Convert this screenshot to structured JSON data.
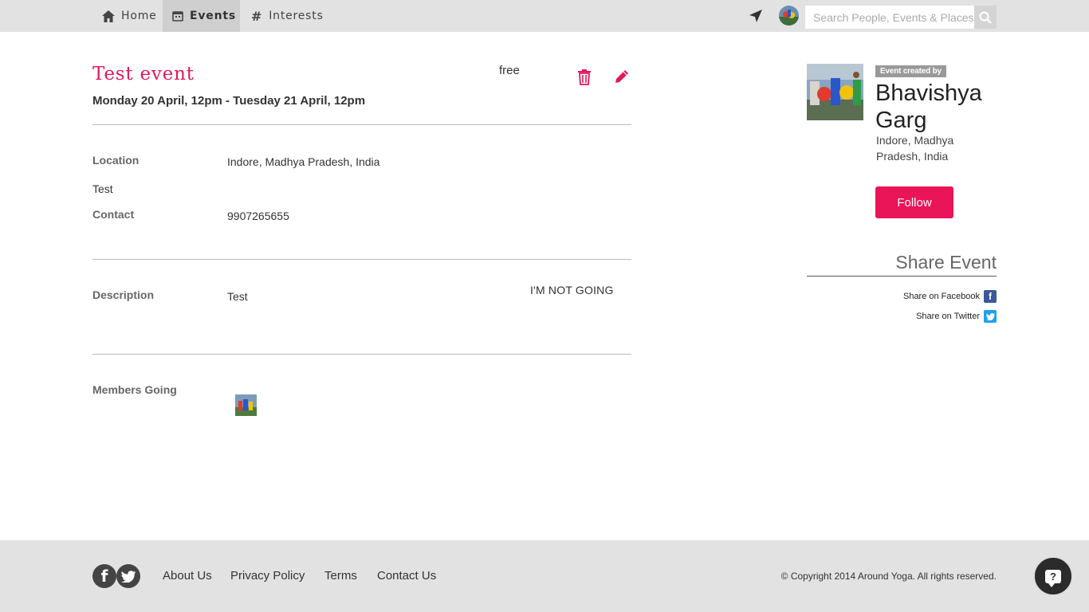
{
  "nav": {
    "tabs": [
      {
        "label": "Home",
        "icon": "home-icon"
      },
      {
        "label": "Events",
        "icon": "calendar-icon",
        "active": true
      },
      {
        "label": "Interests",
        "icon": "hash-icon"
      }
    ],
    "search_placeholder": "Search People, Events & Places"
  },
  "event": {
    "title": "Test event",
    "date_range": "Monday 20 April, 12pm - Tuesday 21 April, 12pm",
    "price": "free",
    "location_label": "Location",
    "location_value": "Indore, Madhya Pradesh, India",
    "venue_text": "Test",
    "contact_label": "Contact",
    "contact_value": "9907265655",
    "description_label": "Description",
    "description_value": "Test",
    "rsvp_label": "I'M NOT GOING",
    "members_label": "Members Going"
  },
  "creator": {
    "badge": "Event created by",
    "name": "Bhavishya Garg",
    "location": "Indore, Madhya Pradesh, India",
    "follow_label": "Follow"
  },
  "share": {
    "heading": "Share Event",
    "facebook_label": "Share on Facebook",
    "twitter_label": "Share on Twitter"
  },
  "footer": {
    "links": [
      "About Us",
      "Privacy Policy",
      "Terms",
      "Contact Us"
    ],
    "copyright": "© Copyright 2014 Around Yoga. All rights reserved."
  },
  "colors": {
    "accent": "#e0195a",
    "follow": "#ea1459",
    "facebook": "#3b5998",
    "twitter": "#1da1f2",
    "bar": "#e2e2e2"
  }
}
